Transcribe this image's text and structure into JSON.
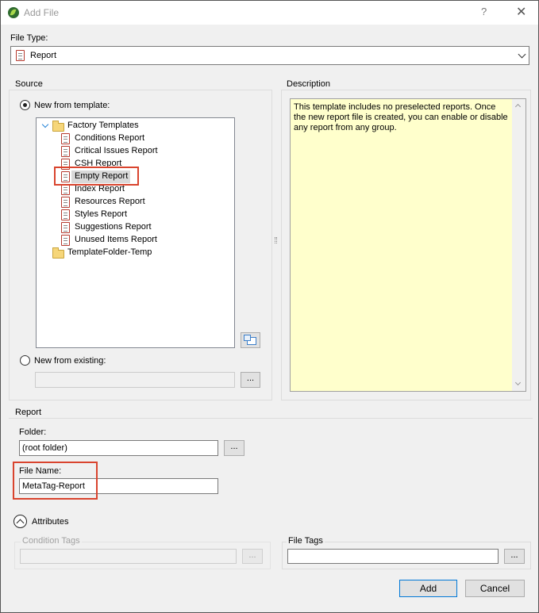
{
  "window": {
    "title": "Add File",
    "help_glyph": "?",
    "close_glyph": "✕"
  },
  "file_type": {
    "label": "File Type:",
    "selected": "Report",
    "icon": "report-icon"
  },
  "source": {
    "group_label": "Source",
    "new_from_template_label": "New from template:",
    "new_from_template_checked": true,
    "tree": [
      {
        "label": "Factory Templates",
        "type": "folder",
        "expanded": true,
        "children": [
          {
            "label": "Conditions Report"
          },
          {
            "label": "Critical Issues Report"
          },
          {
            "label": "CSH Report"
          },
          {
            "label": "Empty Report",
            "selected": true
          },
          {
            "label": "Index Report"
          },
          {
            "label": "Resources Report"
          },
          {
            "label": "Styles Report"
          },
          {
            "label": "Suggestions Report"
          },
          {
            "label": "Unused Items Report"
          }
        ]
      },
      {
        "label": "TemplateFolder-Temp",
        "type": "folder",
        "expanded": false
      }
    ],
    "tree_labels": {
      "folder1": "Factory Templates",
      "item1": "Conditions Report",
      "item2": "Critical Issues Report",
      "item3": "CSH Report",
      "item4": "Empty Report",
      "item5": "Index Report",
      "item6": "Resources Report",
      "item7": "Styles Report",
      "item8": "Suggestions Report",
      "item9": "Unused Items Report",
      "folder2": "TemplateFolder-Temp"
    },
    "new_from_existing_label": "New from existing:",
    "new_from_existing_checked": false,
    "existing_value": "",
    "browse_label": "..."
  },
  "description": {
    "label": "Description",
    "text": "This template includes no preselected reports. Once the new report file is created, you can enable or disable any report from any group."
  },
  "report": {
    "group_label": "Report",
    "folder_label": "Folder:",
    "folder_value": "(root folder)",
    "folder_browse": "...",
    "file_name_label": "File Name:",
    "file_name_value": "MetaTag-Report"
  },
  "attributes": {
    "label": "Attributes",
    "condition_tags_label": "Condition Tags",
    "condition_tags_value": "",
    "condition_browse": "...",
    "file_tags_label": "File Tags",
    "file_tags_value": "",
    "file_tags_browse": "..."
  },
  "buttons": {
    "add": "Add",
    "cancel": "Cancel"
  },
  "colors": {
    "highlight_box": "#d9442e",
    "description_bg": "#ffffcc",
    "primary_border": "#0078d7"
  }
}
